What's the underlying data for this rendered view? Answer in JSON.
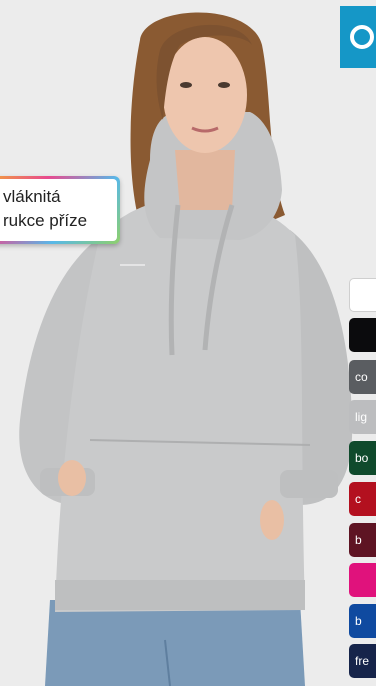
{
  "banner": {
    "line1": "vláknitá",
    "line2": "rukce příze"
  },
  "colors": {
    "hoodie": "#c9cacb",
    "accent": "#1597c7"
  },
  "swatches": [
    {
      "label": "",
      "color": "#ffffff",
      "text_color": "#333333"
    },
    {
      "label": "",
      "color": "#0b0b0d",
      "text_color": "#ffffff"
    },
    {
      "label": "co",
      "color": "#5a5d61",
      "text_color": "#ffffff"
    },
    {
      "label": "lig",
      "color": "#bcbdbf",
      "text_color": "#ffffff"
    },
    {
      "label": "bo",
      "color": "#0f4a2c",
      "text_color": "#ffffff"
    },
    {
      "label": "c",
      "color": "#b3101f",
      "text_color": "#ffffff"
    },
    {
      "label": "b",
      "color": "#5e1423",
      "text_color": "#ffffff"
    },
    {
      "label": "",
      "color": "#e0127c",
      "text_color": "#ffffff"
    },
    {
      "label": "b",
      "color": "#0f4aa0",
      "text_color": "#ffffff"
    },
    {
      "label": "fre",
      "color": "#16244a",
      "text_color": "#ffffff"
    }
  ]
}
